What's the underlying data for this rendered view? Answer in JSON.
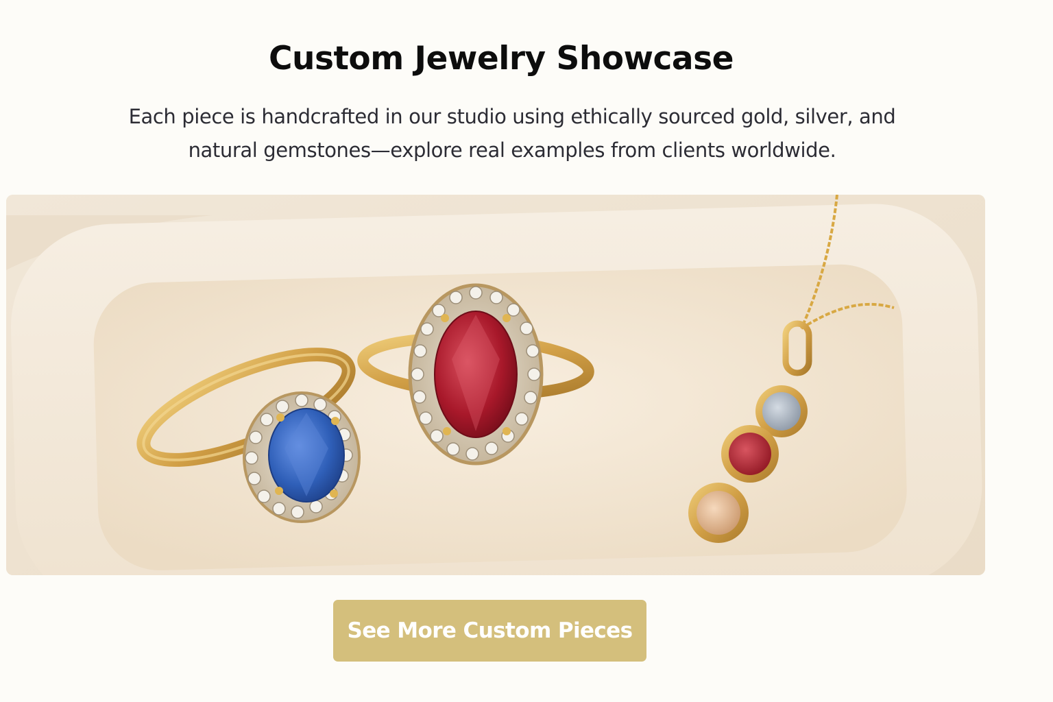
{
  "header": {
    "title": "Custom Jewelry Showcase",
    "intro": "Each piece is handcrafted in our studio using ethically sourced gold, silver, and natural gemstones—explore real examples from clients worldwide."
  },
  "showcase": {
    "items": [
      {
        "name": "sapphire-halo-ring",
        "gem_color": "#2f5fb8",
        "metal_color": "#d6aa52"
      },
      {
        "name": "ruby-halo-ring",
        "gem_color": "#a8182a",
        "metal_color": "#d6aa52"
      },
      {
        "name": "birthstone-pendant-necklace",
        "gem_colors": [
          "#aeb8c4",
          "#b3202c",
          "#e3b68f"
        ],
        "metal_color": "#dcaa45"
      }
    ]
  },
  "cta": {
    "label": "See More Custom Pieces",
    "color": "#d4bf7c"
  }
}
